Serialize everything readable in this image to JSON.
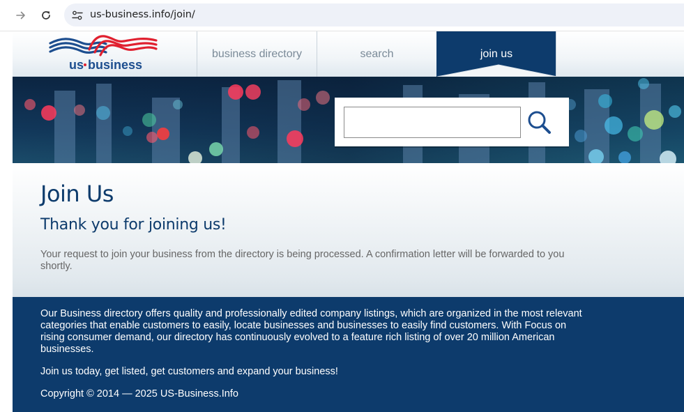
{
  "browser": {
    "url": "us-business.info/join/",
    "icons": {
      "back": "arrow-right-icon",
      "reload": "reload-icon",
      "site_info": "tune-icon"
    }
  },
  "logo": {
    "text": "us·business",
    "colors": {
      "blue": "#1d4e8f",
      "red": "#e0202f"
    }
  },
  "nav": {
    "items": [
      {
        "label": "business directory",
        "active": false
      },
      {
        "label": "search",
        "active": false
      },
      {
        "label": "join us",
        "active": true
      }
    ]
  },
  "search": {
    "value": "",
    "placeholder": "",
    "button_icon": "search-icon"
  },
  "content": {
    "title": "Join Us",
    "subtitle": "Thank you for joining us!",
    "message": "Your request to join your business from the directory is being processed. A confirmation letter will be forwarded to you shortly."
  },
  "footer": {
    "description": "Our Business directory offers quality and professionally edited company listings, which are organized in the most relevant categories that enable customers to easily, locate businesses and businesses to easily find customers. With Focus on rising consumer demand, our directory has continuously evolved to a feature rich listing of over 20 million American businesses.",
    "cta": "Join us today, get listed, get customers and expand your business!",
    "copyright": "Copyright © 2014 — 2025 US-Business.Info"
  },
  "colors": {
    "brand_navy": "#0d3b6c",
    "nav_text": "#7a8a98",
    "body_text": "#666666"
  }
}
